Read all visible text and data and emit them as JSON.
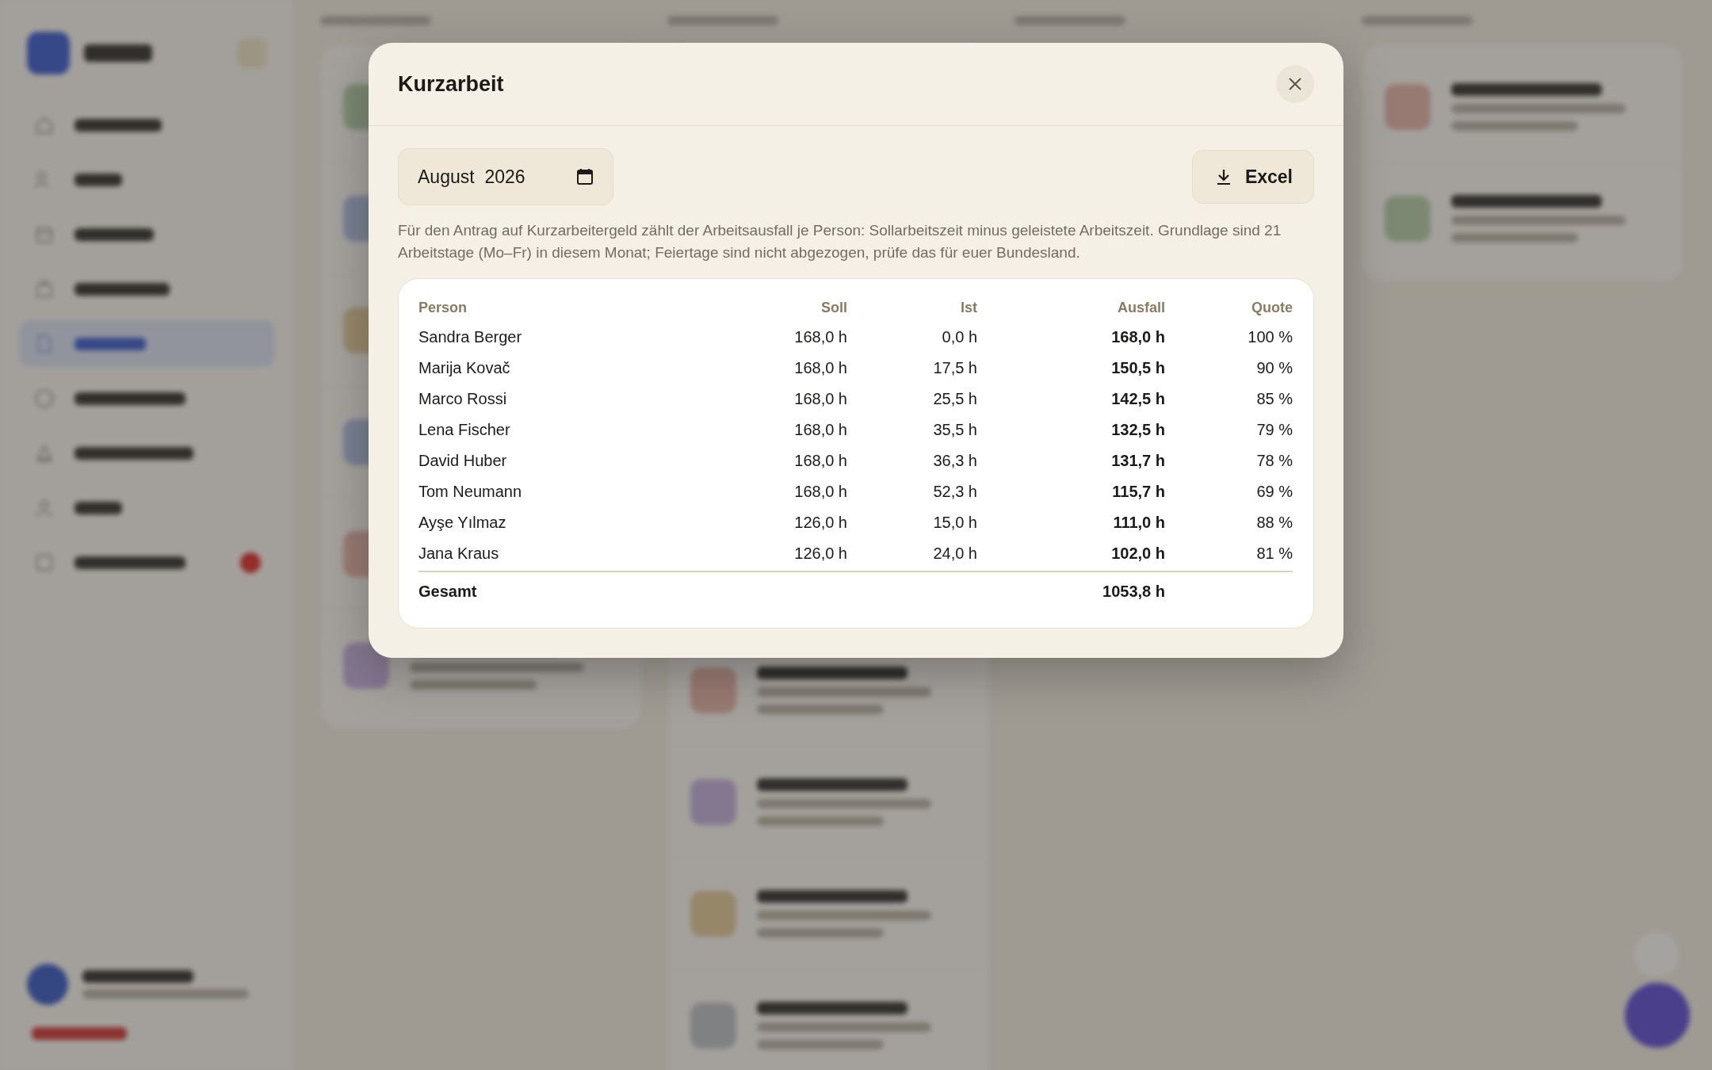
{
  "dialog": {
    "title": "Kurzarbeit",
    "month": "August  2026",
    "export_button": "Excel",
    "description": "Für den Antrag auf Kurzarbeitergeld zählt der Arbeitsausfall je Person: Sollarbeitszeit minus geleistete Arbeitszeit. Grundlage sind 21 Arbeitstage (Mo–Fr) in diesem Monat; Feiertage sind nicht abgezogen, prüfe das für euer Bundesland.",
    "table": {
      "columns": [
        "Person",
        "Soll",
        "Ist",
        "Ausfall",
        "Quote"
      ],
      "rows": [
        [
          "Sandra Berger",
          "168,0 h",
          "0,0 h",
          "168,0 h",
          "100 %"
        ],
        [
          "Marija Kovač",
          "168,0 h",
          "17,5 h",
          "150,5 h",
          "90 %"
        ],
        [
          "Marco Rossi",
          "168,0 h",
          "25,5 h",
          "142,5 h",
          "85 %"
        ],
        [
          "Lena Fischer",
          "168,0 h",
          "35,5 h",
          "132,5 h",
          "79 %"
        ],
        [
          "David Huber",
          "168,0 h",
          "36,3 h",
          "131,7 h",
          "78 %"
        ],
        [
          "Tom Neumann",
          "168,0 h",
          "52,3 h",
          "115,7 h",
          "69 %"
        ],
        [
          "Ayşe Yılmaz",
          "126,0 h",
          "15,0 h",
          "111,0 h",
          "88 %"
        ],
        [
          "Jana Kraus",
          "126,0 h",
          "24,0 h",
          "102,0 h",
          "81 %"
        ]
      ],
      "total": {
        "label": "Gesamt",
        "ausfall": "1053,8 h"
      }
    }
  }
}
